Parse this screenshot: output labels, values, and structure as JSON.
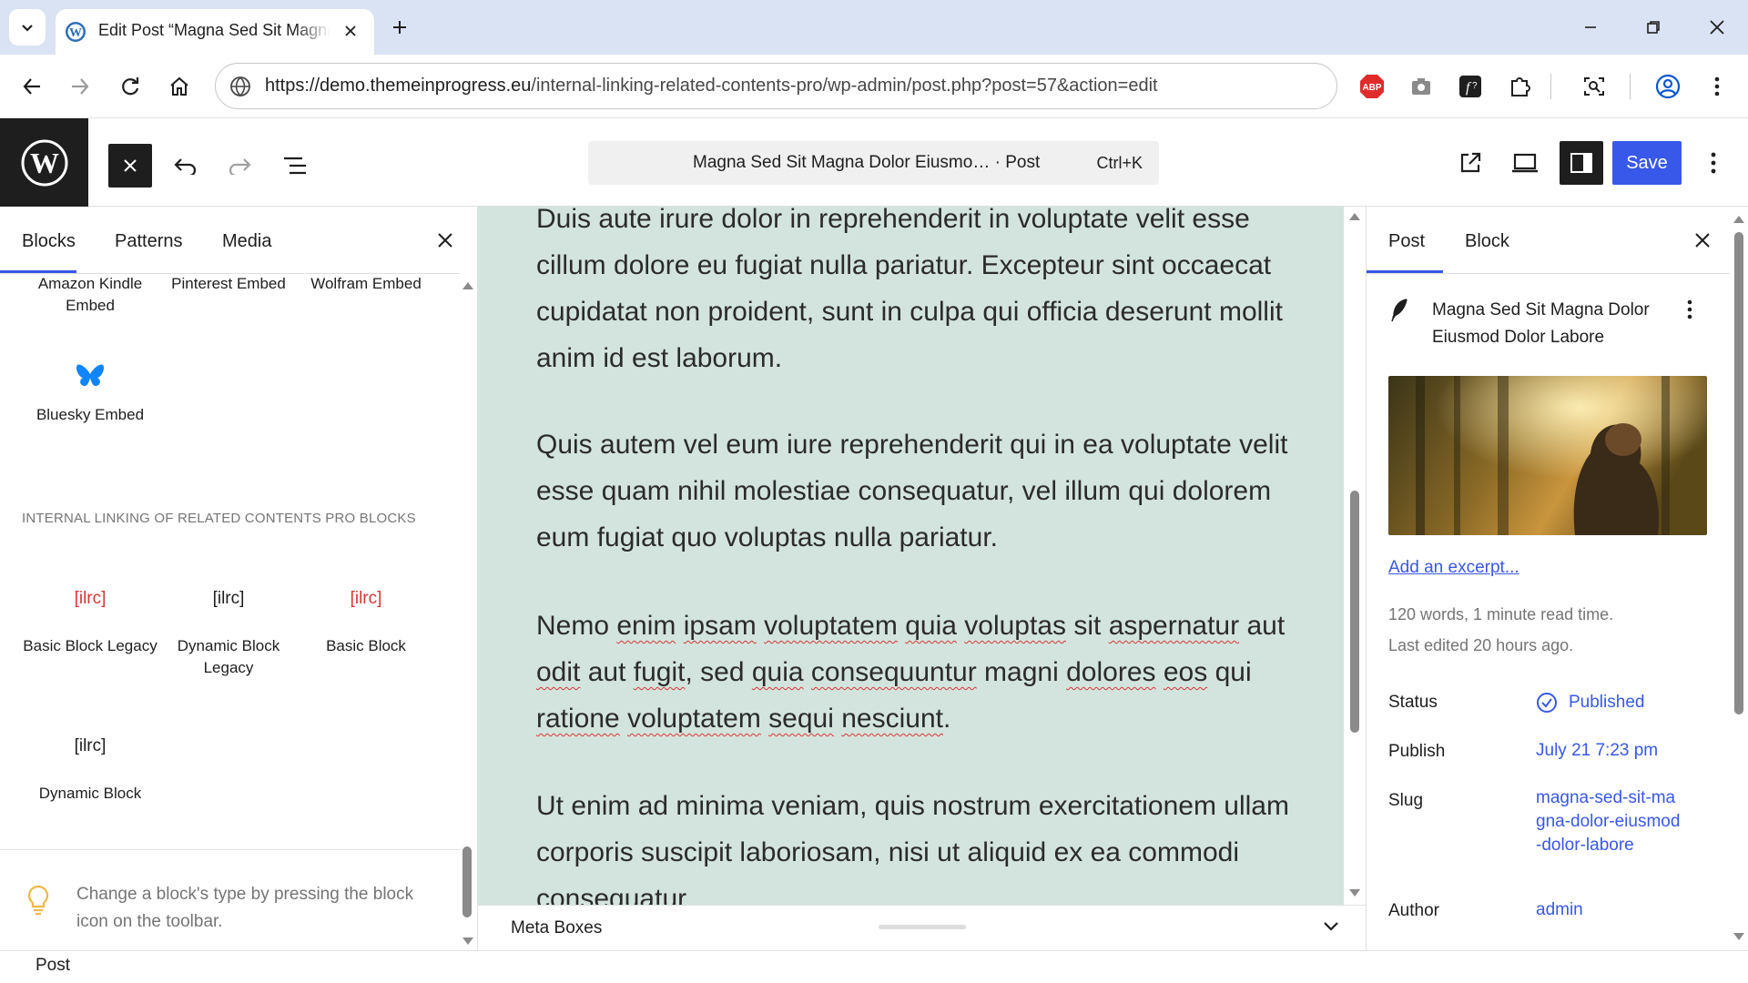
{
  "browser": {
    "tab_title": "Edit Post “Magna Sed Sit Magna Dolor",
    "url_host": "https://demo.themeinprogress.eu",
    "url_path": "/internal-linking-related-contents-pro/wp-admin/post.php?post=57&action=edit",
    "extension_abp": "ABP"
  },
  "header": {
    "command_title": "Magna Sed Sit Magna Dolor Eiusmo… · Post",
    "shortcut": "Ctrl+K",
    "save_label": "Save"
  },
  "inserter": {
    "tabs": [
      "Blocks",
      "Patterns",
      "Media"
    ],
    "embeds_row": [
      "Amazon Kindle Embed",
      "Pinterest Embed",
      "Wolfram Embed"
    ],
    "bluesky_label": "Bluesky Embed",
    "section_heading": "Internal Linking of Related Contents Pro Blocks",
    "ilrc_blocks": [
      {
        "icon": "[ilrc]",
        "label": "Basic Block Legacy",
        "color": "#d63638"
      },
      {
        "icon": "[ilrc]",
        "label": "Dynamic Block Legacy",
        "color": "#1e1e1e"
      },
      {
        "icon": "[ilrc]",
        "label": "Basic Block",
        "color": "#d63638"
      },
      {
        "icon": "[ilrc]",
        "label": "Dynamic Block",
        "color": "#1e1e1e"
      }
    ],
    "tip": "Change a block's type by pressing the block icon on the toolbar."
  },
  "canvas": {
    "paragraphs": [
      "Duis aute irure dolor in reprehenderit in voluptate velit esse cillum dolore eu fugiat nulla pariatur. Excepteur sint occaecat cupidatat non proident, sunt in culpa qui officia deserunt mollit anim id est laborum.",
      "Quis autem vel eum iure reprehenderit qui in ea voluptate velit esse quam nihil molestiae consequatur, vel illum qui dolorem eum fugiat quo voluptas nulla pariatur.",
      "Nemo enim ipsam voluptatem quia voluptas sit aspernatur aut odit aut fugit, sed quia consequuntur magni dolores eos qui ratione voluptatem sequi nesciunt.",
      "Ut enim ad minima veniam, quis nostrum exercitationem ullam corporis suscipit laboriosam, nisi ut aliquid ex ea commodi consequatur"
    ],
    "background_color": "#d3e4de",
    "meta_boxes_label": "Meta Boxes"
  },
  "settings": {
    "tabs": [
      "Post",
      "Block"
    ],
    "post_title": "Magna Sed Sit Magna Dolor Eiusmod Dolor Labore",
    "excerpt_link": "Add an excerpt...",
    "word_count": "120 words, 1 minute read time.",
    "last_edited": "Last edited 20 hours ago.",
    "status_label": "Status",
    "status_value": "Published",
    "publish_label": "Publish",
    "publish_value": "July 21 7:23 pm",
    "slug_label": "Slug",
    "slug_value": "magna-sed-sit-magna-dolor-eiusmod-dolor-labore",
    "author_label": "Author",
    "author_value": "admin"
  },
  "footer": {
    "breadcrumb": "Post"
  },
  "colors": {
    "accent": "#3858e9",
    "dark": "#1e1e1e",
    "error": "#d63638"
  }
}
